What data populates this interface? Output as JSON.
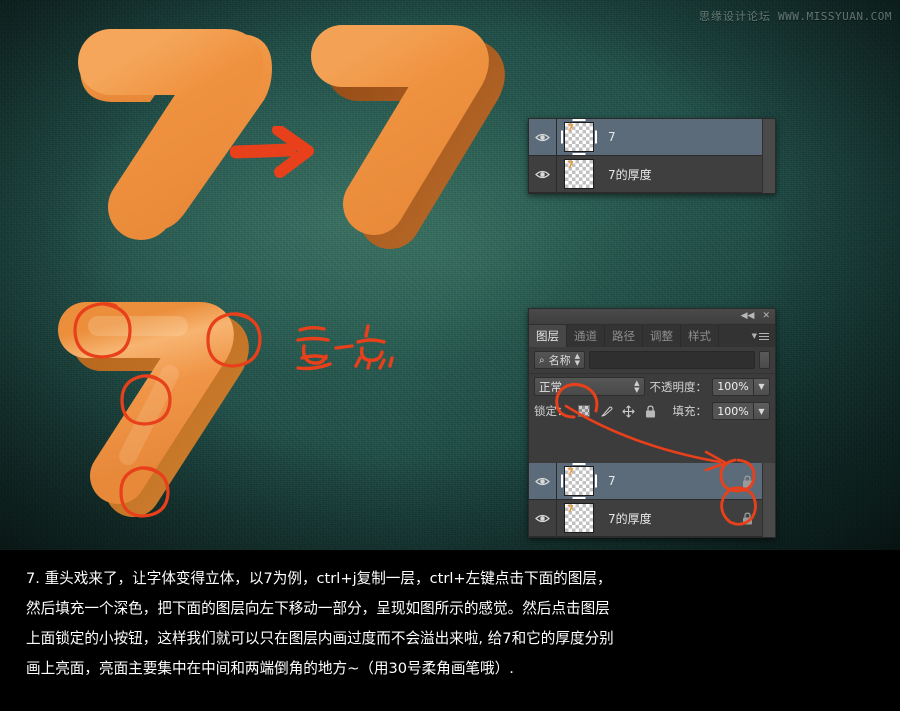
{
  "watermark": {
    "site_cn": "思缘设计论坛",
    "site_url": "WWW.MISSYUAN.COM"
  },
  "canvas": {
    "digit": "7",
    "arrow": "arrow-right",
    "handwritten_note": "亮点",
    "highlight_circles": 4,
    "colors": {
      "background_green": "#21504a",
      "digit_orange": "#ef9240",
      "digit_shadow": "#a85a1e",
      "annotation_red": "#e8401a"
    }
  },
  "top_panel": {
    "name": "layers-panel-top",
    "layers": [
      {
        "name": "7",
        "selected": true,
        "visible": true,
        "thumb_framed": true,
        "locked": false
      },
      {
        "name": "7的厚度",
        "selected": false,
        "visible": true,
        "thumb_framed": false,
        "locked": false
      }
    ]
  },
  "bottom_panel": {
    "name": "layers-panel-full",
    "titlebar": {
      "collapse": "◀◀",
      "close": "✕"
    },
    "tabs": [
      {
        "label": "图层",
        "active": true
      },
      {
        "label": "通道",
        "active": false
      },
      {
        "label": "路径",
        "active": false
      },
      {
        "label": "调整",
        "active": false
      },
      {
        "label": "样式",
        "active": false
      }
    ],
    "filter": {
      "kind_label": "名称",
      "search_icon": "search-icon",
      "field_value": "",
      "field_placeholder": ""
    },
    "blend": {
      "mode": "正常",
      "opacity_label": "不透明度：",
      "opacity_value": "100%"
    },
    "lock": {
      "lock_label": "锁定：",
      "icons": [
        "transparency-checker-icon",
        "brush-icon",
        "move-icon",
        "lock-icon"
      ],
      "fill_label": "填充：",
      "fill_value": "100%"
    },
    "layers": [
      {
        "name": "7",
        "selected": true,
        "visible": true,
        "thumb_framed": true,
        "locked": true
      },
      {
        "name": "7的厚度",
        "selected": false,
        "visible": true,
        "thumb_framed": false,
        "locked": true
      }
    ]
  },
  "caption": {
    "lines": [
      "7. 重头戏来了，让字体变得立体，以7为例，ctrl+j复制一层，ctrl+左键点击下面的图层，",
      "然后填充一个深色，把下面的图层向左下移动一部分，呈现如图所示的感觉。然后点击图层",
      "上面锁定的小按钮，这样我们就可以只在图层内画过度而不会溢出来啦, 给7和它的厚度分别",
      "画上亮面，亮面主要集中在中间和两端倒角的地方~（用30号柔角画笔哦）."
    ]
  }
}
